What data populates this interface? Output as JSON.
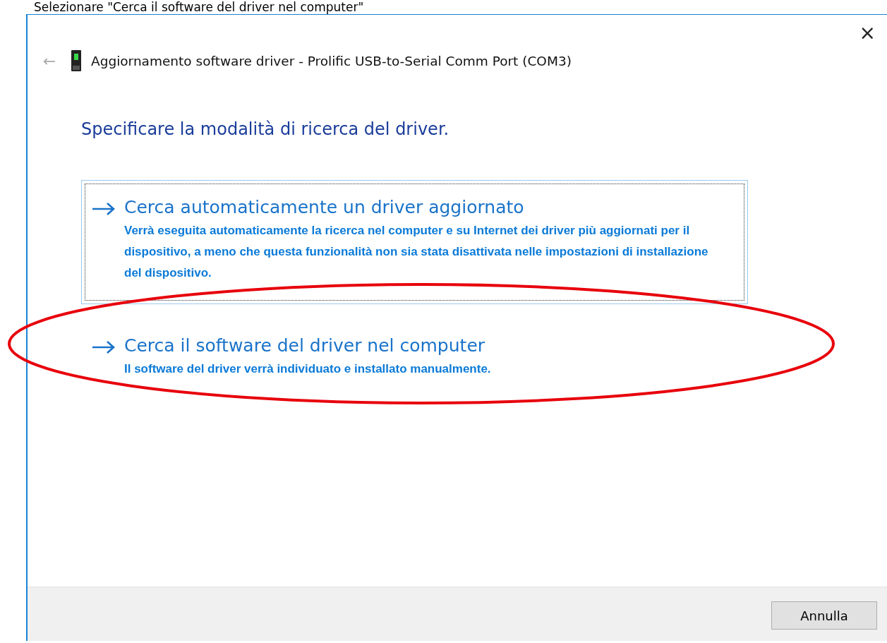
{
  "caption": "Selezionare \"Cerca il software del driver nel computer\"",
  "window": {
    "title": "Aggiornamento software driver - Prolific USB-to-Serial Comm Port (COM3)",
    "close": "×",
    "back": "←"
  },
  "heading": "Specificare la modalità di ricerca del driver.",
  "options": [
    {
      "title": "Cerca automaticamente un driver aggiornato",
      "description": "Verrà eseguita automaticamente la ricerca nel computer e su Internet dei driver più aggiornati per il dispositivo, a meno che questa funzionalità non sia stata disattivata nelle impostazioni di installazione del dispositivo.",
      "focused": true,
      "highlighted": false
    },
    {
      "title": "Cerca il software del driver nel computer",
      "description": "Il software del driver verrà individuato e installato manualmente.",
      "focused": false,
      "highlighted": true
    }
  ],
  "buttons": [
    "Annulla"
  ]
}
